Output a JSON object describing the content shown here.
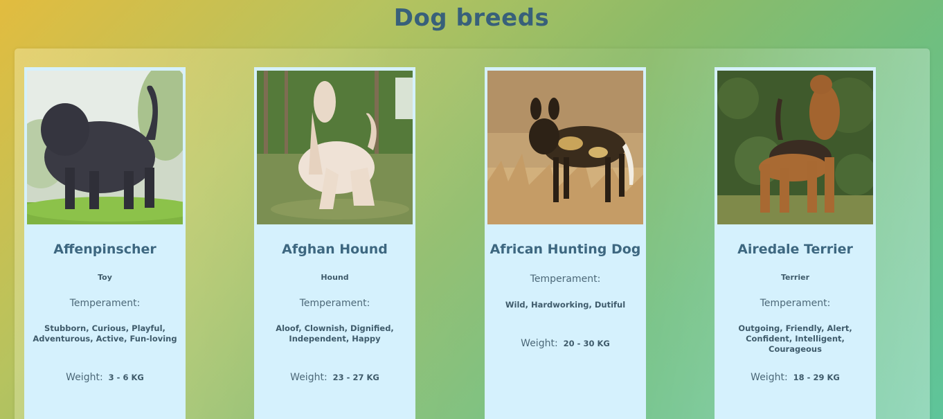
{
  "page": {
    "title": "Dog breeds"
  },
  "labels": {
    "temperament": "Temperament:",
    "weight": "Weight:"
  },
  "breeds": [
    {
      "name": "Affenpinscher",
      "group": "Toy",
      "temperament": "Stubborn, Curious, Playful, Adventurous, Active, Fun-loving",
      "weight": "3 - 6 KG",
      "image": "affenpinscher-photo"
    },
    {
      "name": "Afghan Hound",
      "group": "Hound",
      "temperament": "Aloof, Clownish, Dignified, Independent, Happy",
      "weight": "23 - 27 KG",
      "image": "afghan-hound-photo"
    },
    {
      "name": "African Hunting Dog",
      "group": "",
      "temperament": "Wild, Hardworking, Dutiful",
      "weight": "20 - 30 KG",
      "image": "african-hunting-dog-photo"
    },
    {
      "name": "Airedale Terrier",
      "group": "Terrier",
      "temperament": "Outgoing, Friendly, Alert, Confident, Intelligent, Courageous",
      "weight": "18 - 29 KG",
      "image": "airedale-terrier-photo"
    }
  ]
}
